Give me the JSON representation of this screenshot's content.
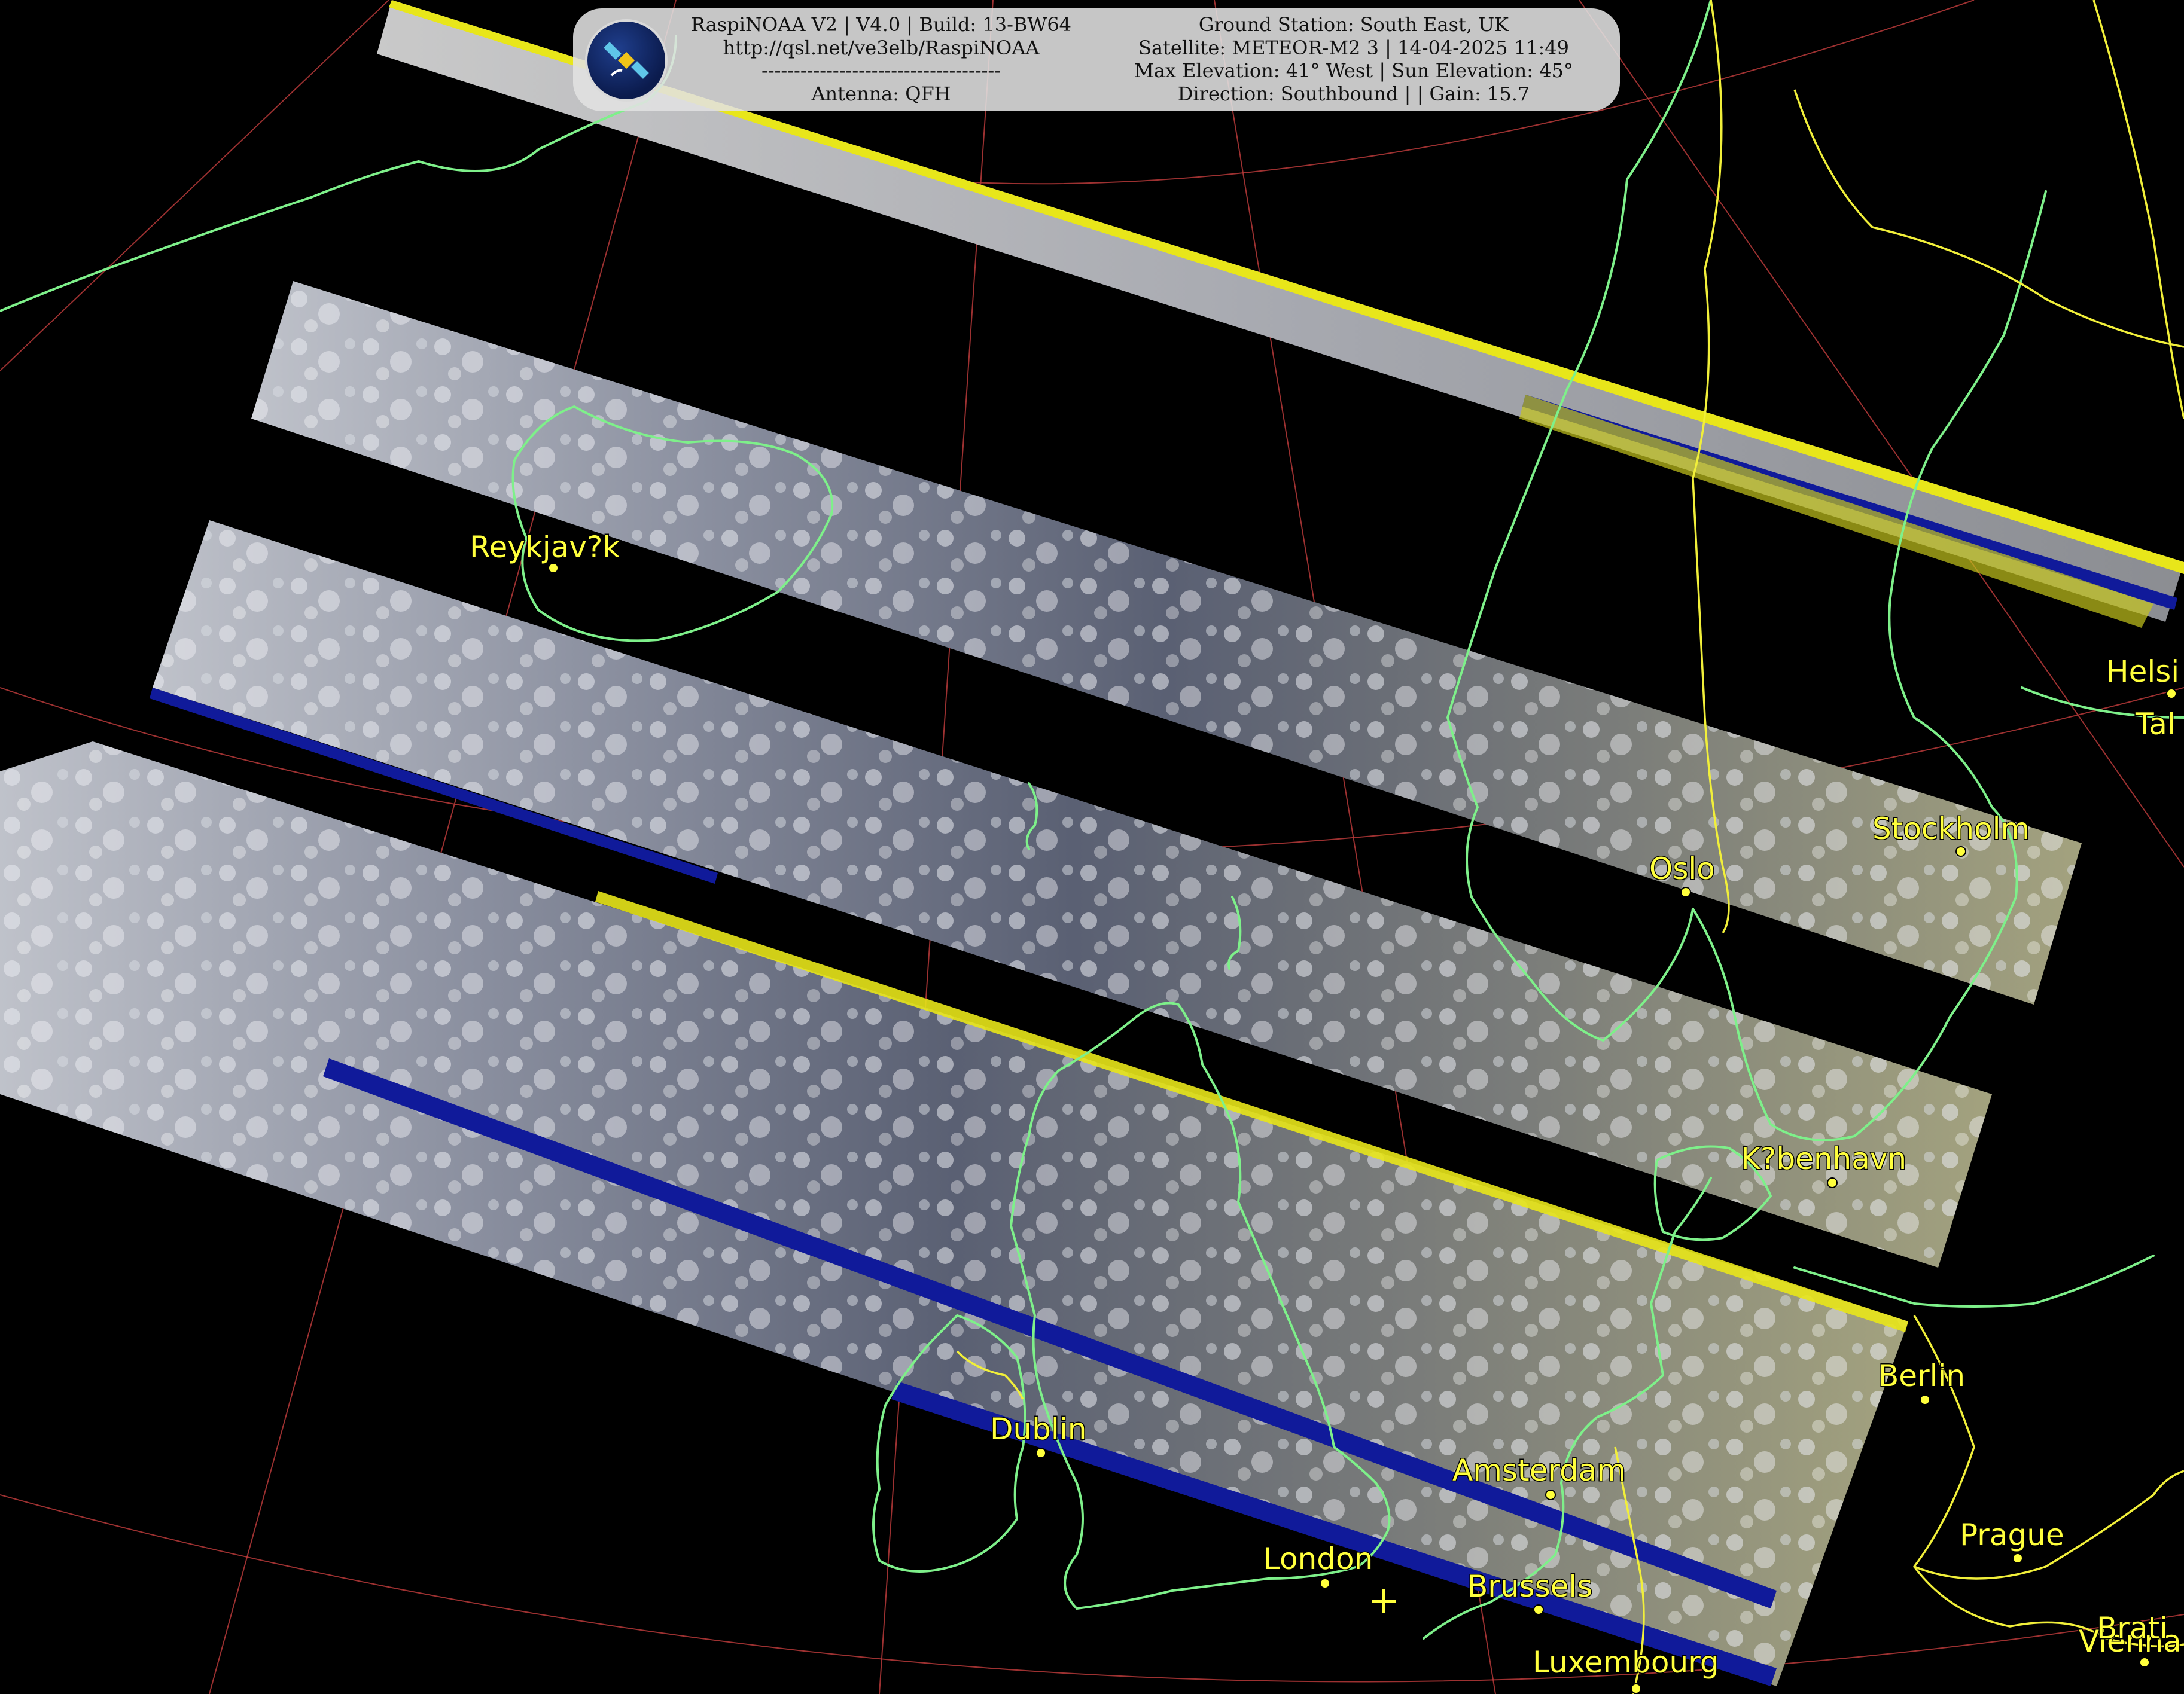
{
  "info_panel": {
    "left_lines": [
      "RaspiNOAA V2 | V4.0 | Build: 13-BW64",
      "http://qsl.net/ve3elb/RaspiNOAA",
      "-------------------------------------",
      "Antenna: QFH"
    ],
    "right_lines": [
      "Ground Station: South East, UK",
      "Satellite: METEOR-M2 3 | 14-04-2025 11:49",
      "Max Elevation: 41° West | Sun Elevation: 45°",
      "Direction: Southbound | | Gain: 15.7"
    ],
    "logo_icon": "satellite-icon"
  },
  "cities": [
    {
      "name": "Reykjav?k",
      "key": "reykjavik"
    },
    {
      "name": "Oslo",
      "key": "oslo"
    },
    {
      "name": "Stockholm",
      "key": "stockholm"
    },
    {
      "name": "Helsi",
      "key": "helsinki"
    },
    {
      "name": "Tal",
      "key": "tallinn"
    },
    {
      "name": "K?benhavn",
      "key": "kobenhavn"
    },
    {
      "name": "Berlin",
      "key": "berlin"
    },
    {
      "name": "Dublin",
      "key": "dublin"
    },
    {
      "name": "Amsterdam",
      "key": "amsterdam"
    },
    {
      "name": "London",
      "key": "london"
    },
    {
      "name": "Brussels",
      "key": "brussels"
    },
    {
      "name": "Luxembourg",
      "key": "luxembourg"
    },
    {
      "name": "Prague",
      "key": "prague"
    },
    {
      "name": "Vienna",
      "key": "vienna"
    },
    {
      "name": "Brati",
      "key": "bratislava"
    }
  ],
  "colors": {
    "background": "#000000",
    "coastline": "#7ef08a",
    "border": "#f1ef3a",
    "graticule": "#b83a3a",
    "city_label": "#ffff3c",
    "panel": "#e1e1e1",
    "swath_edge_yellow": "#e8e61a",
    "swath_edge_blue": "#101a9a"
  },
  "ground_station_marker": "cross-marker-icon"
}
